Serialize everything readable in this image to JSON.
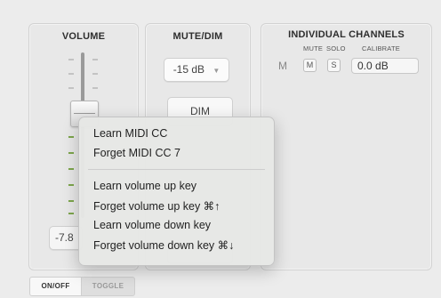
{
  "volume": {
    "title": "VOLUME",
    "value": "-7.8",
    "onoff_label": "ON/OFF",
    "toggle_label": "TOGGLE"
  },
  "mute_dim": {
    "title": "MUTE/DIM",
    "dim_amount": "-15 dB",
    "dim_label": "DIM"
  },
  "channels": {
    "title": "INDIVIDUAL CHANNELS",
    "mute_header": "MUTE",
    "solo_header": "SOLO",
    "calibrate_header": "CALIBRATE",
    "channel_name": "M",
    "mute_button": "M",
    "solo_button": "S",
    "calibrate_value": "0.0 dB"
  },
  "context_menu": {
    "items": [
      "Learn MIDI CC",
      "Forget MIDI CC 7",
      "Learn volume up key",
      "Forget volume up key ⌘↑",
      "Learn volume down key",
      "Forget volume down key ⌘↓"
    ]
  },
  "colors": {
    "meter_green": "#7da64d",
    "background": "#ececec"
  }
}
